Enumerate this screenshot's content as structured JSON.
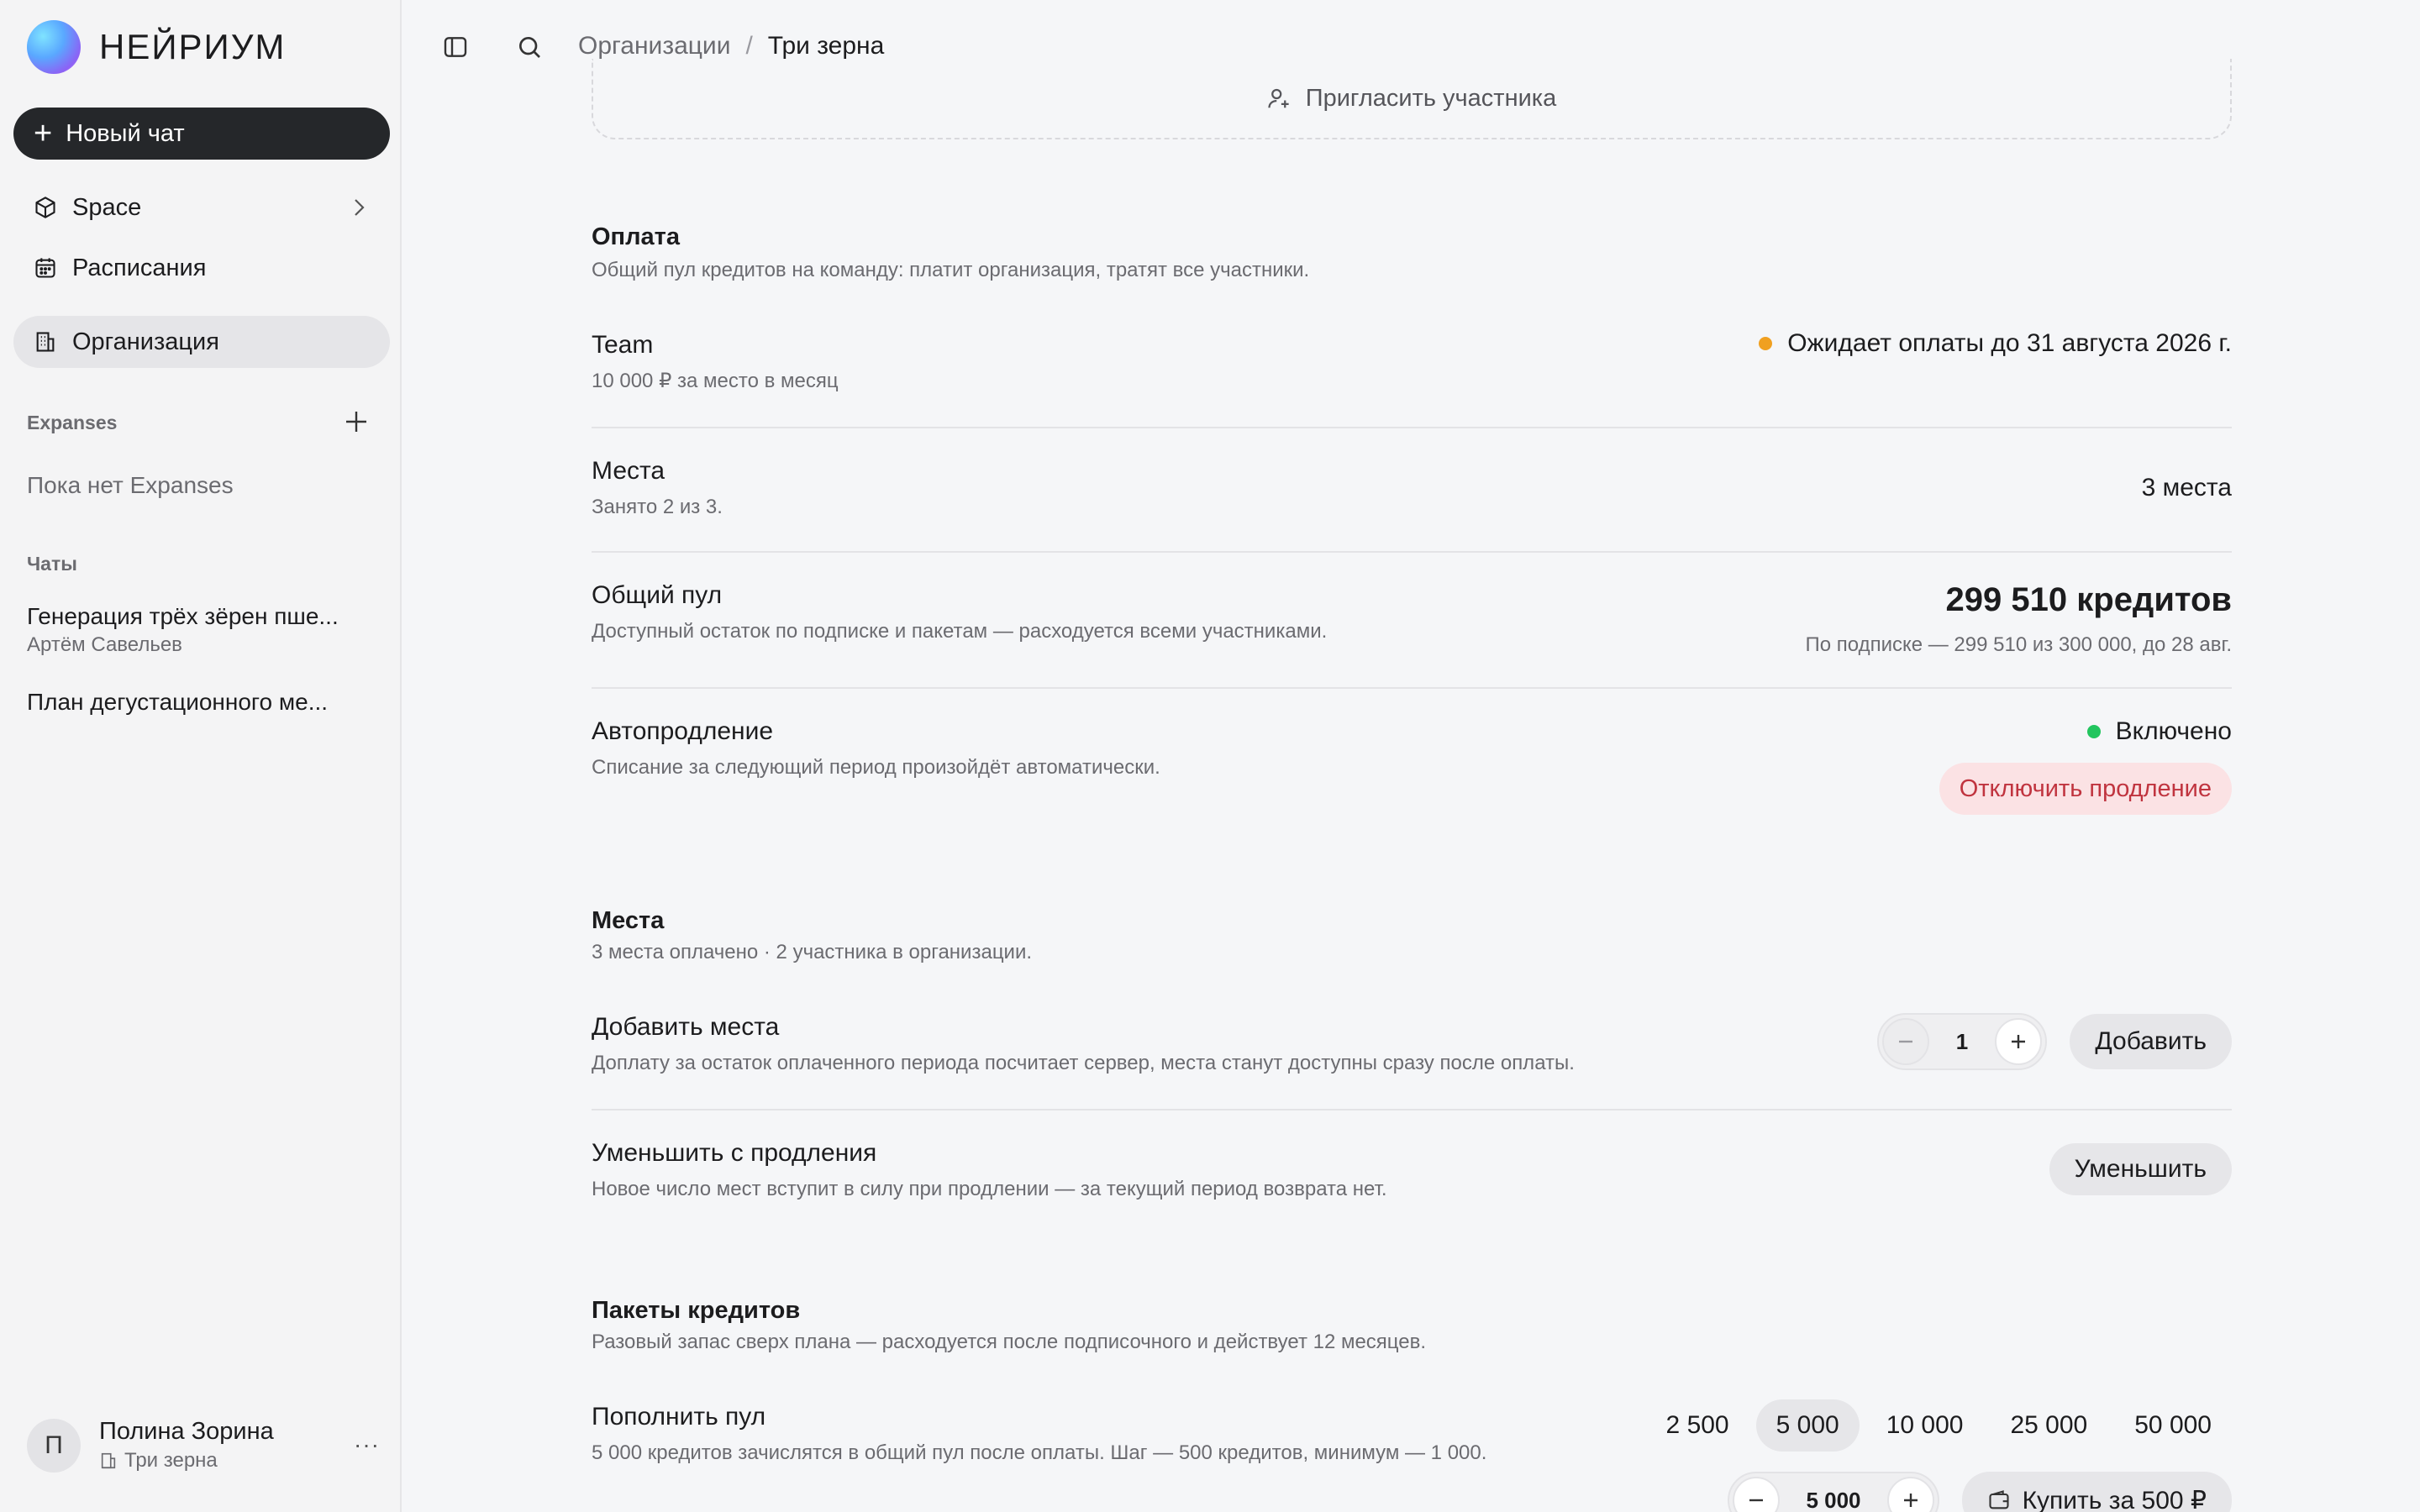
{
  "brand": {
    "name": "НЕЙРИУМ"
  },
  "sidebar": {
    "new_chat": "Новый чат",
    "items": [
      {
        "label": "Space"
      },
      {
        "label": "Расписания"
      },
      {
        "label": "Организация"
      }
    ],
    "expanses_label": "Expanses",
    "expanses_empty": "Пока нет Expanses",
    "chats_label": "Чаты",
    "chats": [
      {
        "title": "Генерация трёх зёрен пше...",
        "author": "Артём Савельев"
      },
      {
        "title": "План дегустационного ме..."
      }
    ],
    "user": {
      "initial": "П",
      "name": "Полина Зорина",
      "org": "Три зерна",
      "more": "···"
    }
  },
  "topbar": {
    "breadcrumb_parent": "Организации",
    "breadcrumb_sep": "/",
    "breadcrumb_current": "Три зерна"
  },
  "invite": {
    "label": "Пригласить участника"
  },
  "payment": {
    "title": "Оплата",
    "desc": "Общий пул кредитов на команду: платит организация, тратят все участники.",
    "plan": {
      "name": "Team",
      "price": "10 000 ₽ за место в месяц",
      "status": "Ожидает оплаты до 31 августа 2026 г.",
      "status_color": "#f0a020"
    },
    "seats": {
      "title": "Места",
      "desc": "Занято 2 из 3.",
      "value": "3 места"
    },
    "pool": {
      "title": "Общий пул",
      "desc": "Доступный остаток по подписке и пакетам — расходуется всеми участниками.",
      "value": "299 510 кредитов",
      "detail": "По подписке — 299 510 из 300 000, до 28 авг."
    },
    "autorenew": {
      "title": "Автопродление",
      "desc": "Списание за следующий период произойдёт автоматически.",
      "status": "Включено",
      "status_color": "#22c55e",
      "button": "Отключить продление"
    }
  },
  "seats_section": {
    "title": "Места",
    "desc": "3 места оплачено · 2 участника в организации.",
    "add": {
      "title": "Добавить места",
      "desc": "Доплату за остаток оплаченного периода посчитает сервер, места станут доступны сразу после оплаты.",
      "qty": "1",
      "button": "Добавить"
    },
    "reduce": {
      "title": "Уменьшить с продления",
      "desc": "Новое число мест вступит в силу при продлении — за текущий период возврата нет.",
      "button": "Уменьшить"
    }
  },
  "packs": {
    "title": "Пакеты кредитов",
    "desc": "Разовый запас сверх плана — расходуется после подписочного и действует 12 месяцев.",
    "topup": {
      "title": "Пополнить пул",
      "desc": "5 000 кредитов зачислятся в общий пул после оплаты. Шаг — 500 кредитов, минимум — 1 000.",
      "options": [
        "2 500",
        "5 000",
        "10 000",
        "25 000",
        "50 000"
      ],
      "selected": "5 000",
      "qty": "5 000",
      "buy_button": "Купить за 500 ₽"
    }
  }
}
